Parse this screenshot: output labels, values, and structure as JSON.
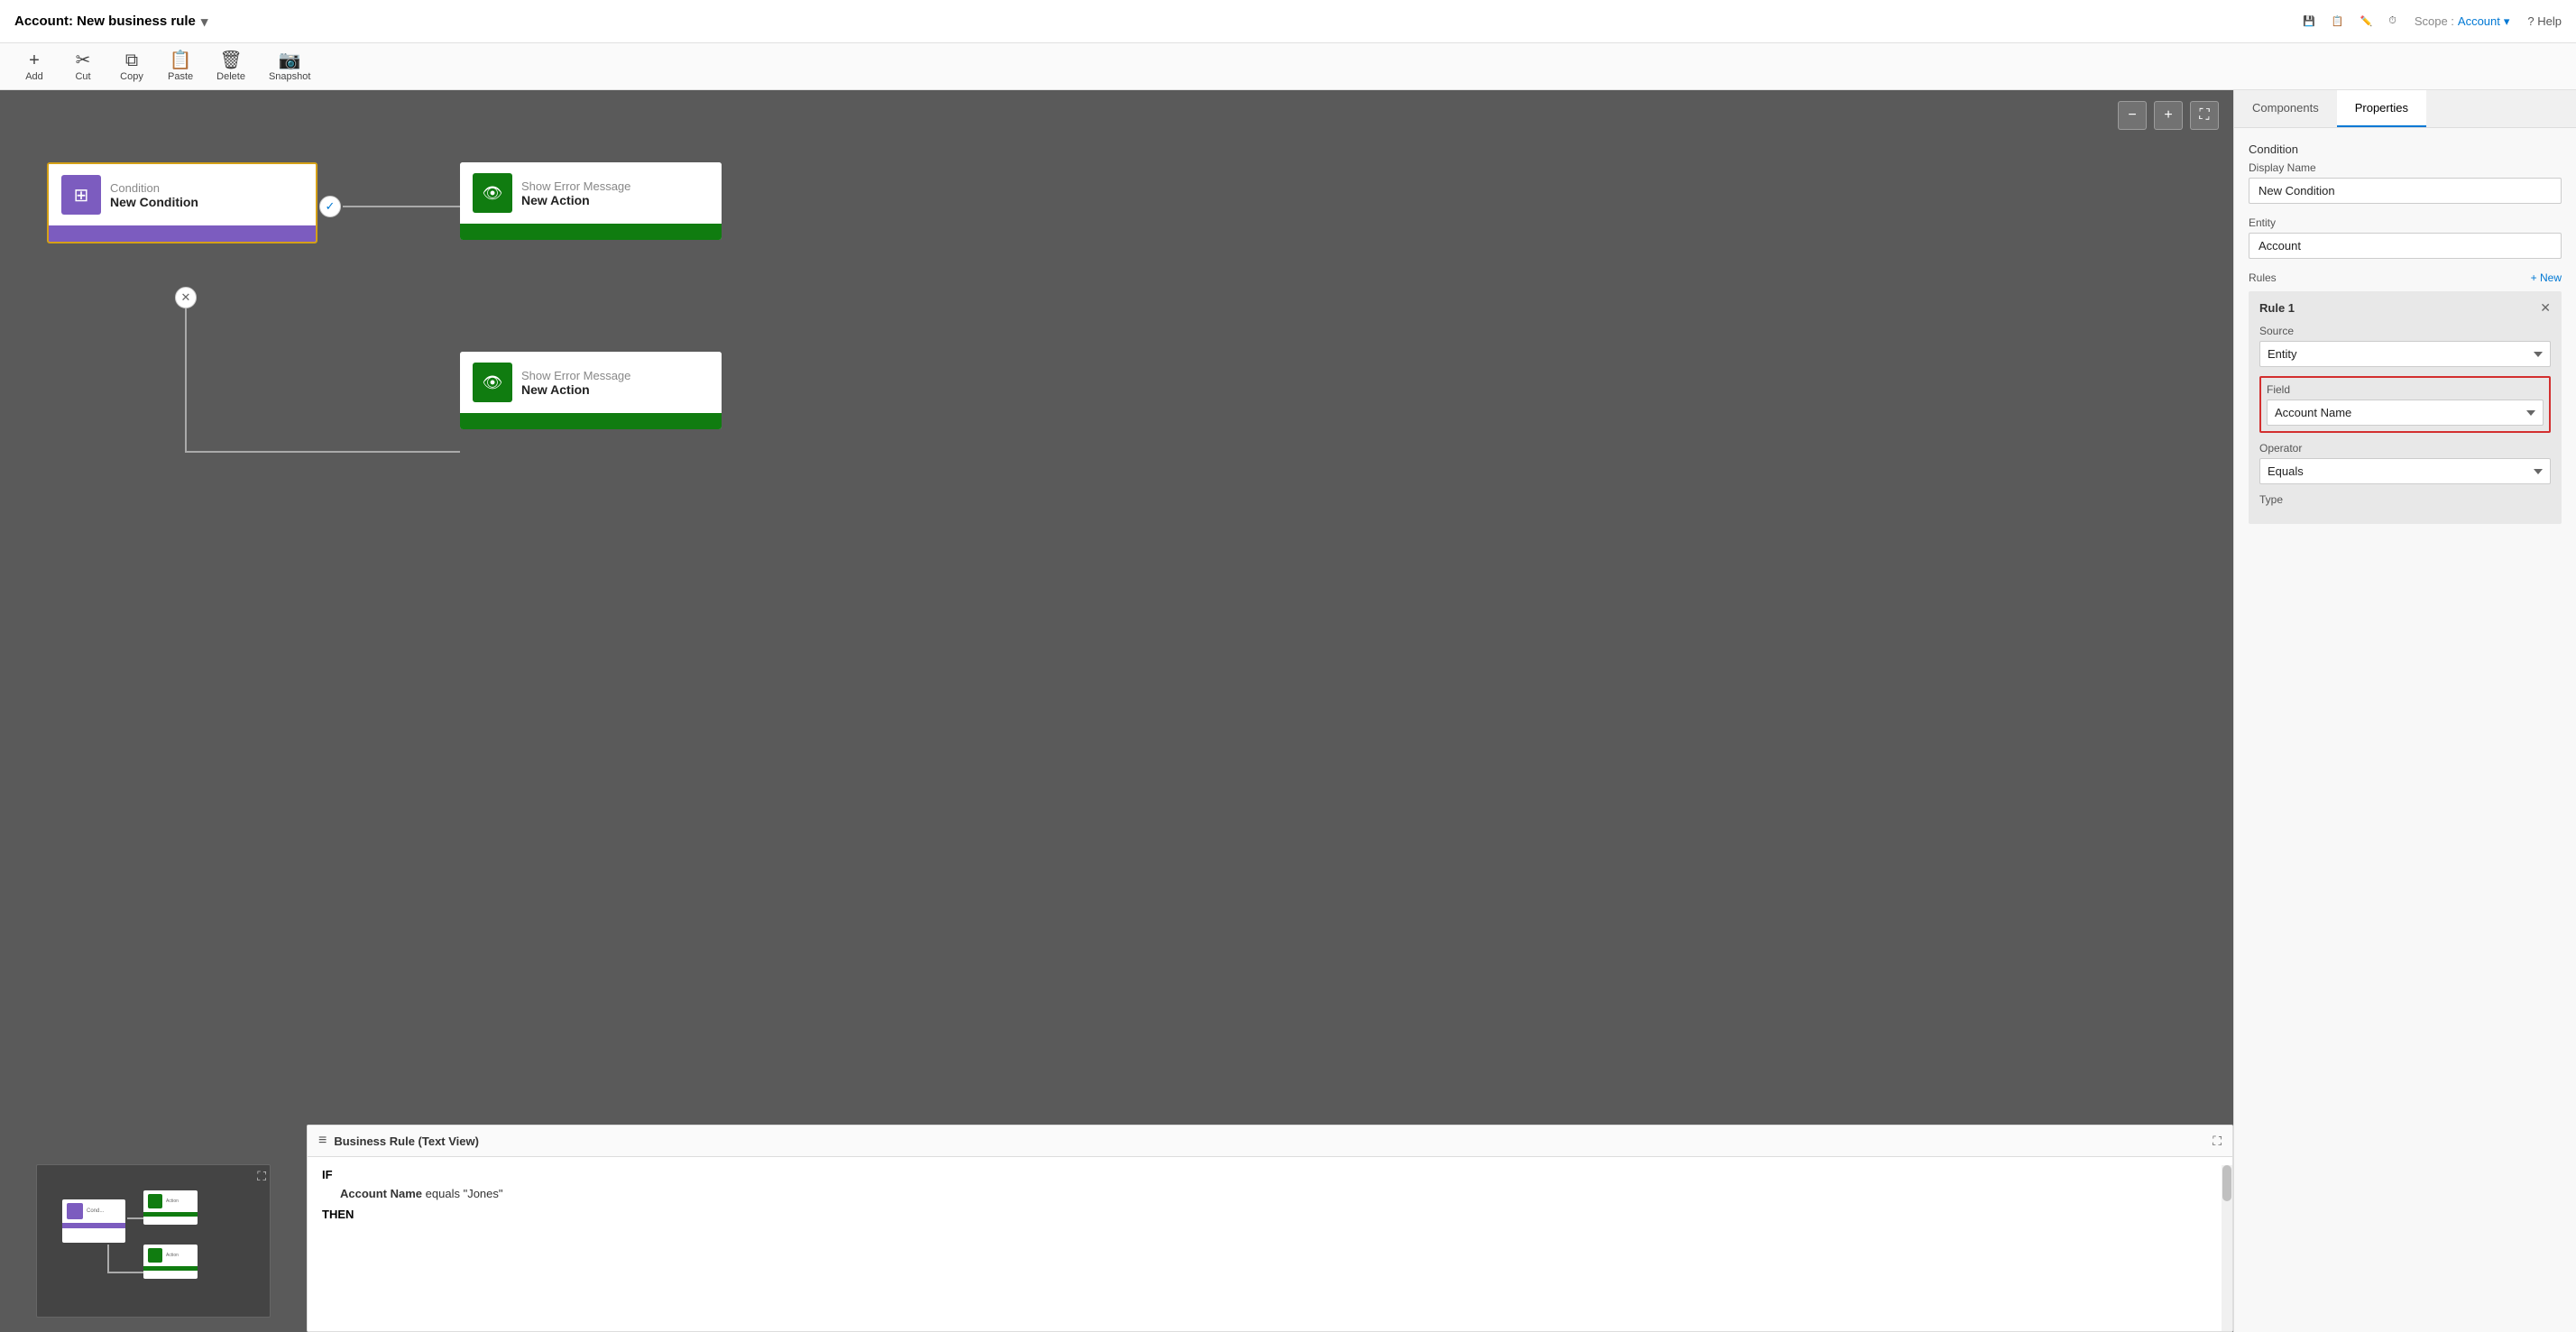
{
  "titleBar": {
    "title": "Account: New business rule",
    "chevronIcon": "▾",
    "topIcons": [
      {
        "name": "save-icon",
        "glyph": "💾",
        "label": ""
      },
      {
        "name": "publish-icon",
        "glyph": "📋",
        "label": ""
      },
      {
        "name": "edit-icon",
        "glyph": "✎",
        "label": ""
      },
      {
        "name": "history-icon",
        "glyph": "⏱",
        "label": ""
      }
    ],
    "scope": {
      "label": "Scope :",
      "value": "Account",
      "chevron": "▾"
    },
    "help": "? Help"
  },
  "toolbar": {
    "buttons": [
      {
        "name": "add-button",
        "glyph": "+",
        "label": "Add"
      },
      {
        "name": "cut-button",
        "glyph": "✂",
        "label": "Cut"
      },
      {
        "name": "copy-button",
        "glyph": "⧉",
        "label": "Copy"
      },
      {
        "name": "paste-button",
        "glyph": "📋",
        "label": "Paste"
      },
      {
        "name": "delete-button",
        "glyph": "🗑",
        "label": "Delete"
      },
      {
        "name": "snapshot-button",
        "glyph": "📷",
        "label": "Snapshot"
      }
    ]
  },
  "canvas": {
    "zoomOut": "−",
    "zoomIn": "+",
    "expand": "⛶"
  },
  "conditionNode": {
    "iconGlyph": "⊞",
    "type": "Condition",
    "name": "New Condition"
  },
  "checkConnector": "✓",
  "xConnector": "✕",
  "actionNode1": {
    "iconGlyph": "👁",
    "type": "Show Error Message",
    "name": "New Action"
  },
  "actionNode2": {
    "iconGlyph": "👁",
    "type": "Show Error Message",
    "name": "New Action"
  },
  "bizRule": {
    "title": "Business Rule (Text View)",
    "listIcon": "≡",
    "expandIcon": "⛶",
    "if": "IF",
    "condition": "Account Name equals \"Jones\"",
    "conditionBold": "Account Name",
    "then": "THEN"
  },
  "rightPanel": {
    "tabs": [
      "Components",
      "Properties"
    ],
    "activeTab": "Properties",
    "sectionLabel": "Condition",
    "displayNameLabel": "Display Name",
    "displayNameValue": "New Condition",
    "entityLabel": "Entity",
    "entityValue": "Account",
    "rulesLabel": "Rules",
    "newBtnLabel": "+ New",
    "rule": {
      "title": "Rule 1",
      "closeIcon": "✕",
      "sourceLabel": "Source",
      "sourceValue": "Entity",
      "fieldLabel": "Field",
      "fieldValue": "Account Name",
      "operatorLabel": "Operator",
      "operatorValue": "Equals",
      "typeLabel": "Type"
    }
  }
}
